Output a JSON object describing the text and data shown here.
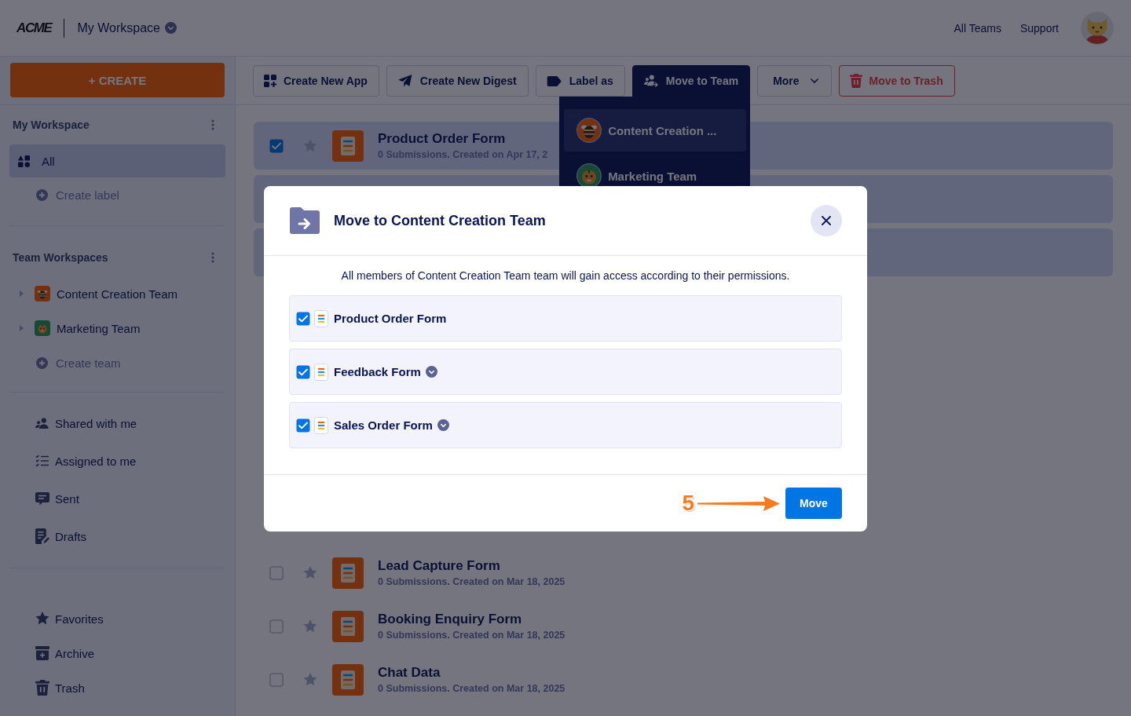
{
  "header": {
    "logo": "ACME",
    "workspace": "My Workspace",
    "links": [
      "All Teams",
      "Support"
    ]
  },
  "sidebar": {
    "create_button": "+ CREATE",
    "my_workspace": {
      "title": "My Workspace",
      "items": [
        {
          "label": "All",
          "selected": true
        }
      ],
      "add": "Create label"
    },
    "team_workspaces": {
      "title": "Team Workspaces",
      "items": [
        {
          "label": "Content Creation Team",
          "expanded": false,
          "selected": false
        },
        {
          "label": "Marketing Team",
          "expanded": false,
          "selected": false
        }
      ],
      "add": "Create team"
    },
    "shared": [
      {
        "label": "Shared with me",
        "selected": false
      },
      {
        "label": "Assigned to me",
        "selected": false
      },
      {
        "label": "Sent",
        "selected": false
      },
      {
        "label": "Drafts",
        "selected": false
      }
    ],
    "other": [
      {
        "label": "Favorites",
        "selected": false
      },
      {
        "label": "Archive",
        "selected": false
      },
      {
        "label": "Trash",
        "selected": false
      }
    ]
  },
  "toolbar": [
    {
      "label": "Create New App",
      "kind": "plain",
      "active": false
    },
    {
      "label": "Create New Digest",
      "kind": "plain",
      "active": false
    },
    {
      "label": "Label as",
      "kind": "plain",
      "active": false
    },
    {
      "label": "Move to Team",
      "kind": "plain",
      "active": true
    },
    {
      "label": "More",
      "kind": "menu",
      "active": false
    },
    {
      "label": "Move to Trash",
      "kind": "danger",
      "active": false
    }
  ],
  "team_menu": {
    "items": [
      {
        "label": "Content Creation ...",
        "selected": true
      },
      {
        "label": "Marketing Team",
        "selected": false
      }
    ]
  },
  "forms": [
    {
      "title": "Product Order Form",
      "subtitle": "0 Submissions. Created on Apr 17, 2",
      "selected": true,
      "starred": false
    },
    {
      "selected": true
    },
    {
      "selected": true
    },
    {
      "selected": false
    },
    {
      "selected": false
    },
    {
      "selected": false
    },
    {
      "selected": false
    },
    {
      "selected": false
    },
    {
      "title": "Lead Capture Form",
      "subtitle": "0 Submissions. Created on Mar 18, 2025",
      "selected": false,
      "starred": false
    },
    {
      "title": "Booking Enquiry Form",
      "subtitle": "0 Submissions. Created on Mar 18, 2025",
      "selected": false,
      "starred": false
    },
    {
      "title": "Chat Data",
      "subtitle": "0 Submissions. Created on Mar 18, 2025",
      "selected": false,
      "starred": false
    }
  ],
  "dialog": {
    "title": "Move to Content Creation Team",
    "message": "All members of Content Creation Team team will gain access according to their permissions.",
    "items": [
      {
        "title": "Product Order Form",
        "checked": true,
        "dropdown": false
      },
      {
        "title": "Feedback Form",
        "checked": true,
        "dropdown": true
      },
      {
        "title": "Sales Order Form",
        "checked": true,
        "dropdown": true
      }
    ],
    "button": "Move"
  },
  "annotation": {
    "step": "5"
  }
}
